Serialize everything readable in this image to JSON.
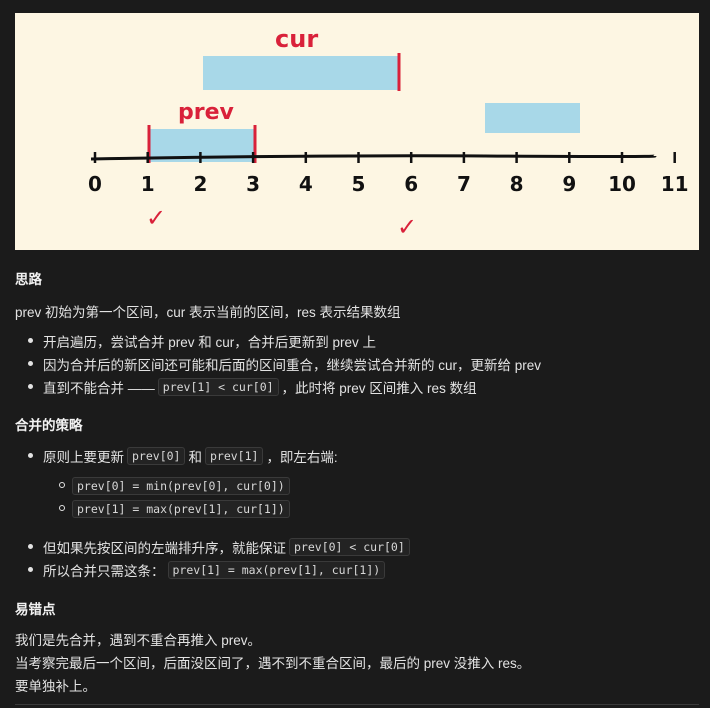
{
  "figure": {
    "axis_ticks": [
      "0",
      "1",
      "2",
      "3",
      "4",
      "5",
      "6",
      "7",
      "8",
      "9",
      "10",
      "11"
    ],
    "label_cur": "cur",
    "label_prev": "prev",
    "check_mark": "✓",
    "colors": {
      "background": "#fdf6e3",
      "interval": "#a8d8e8",
      "endpoint": "#d9213a",
      "axis": "#111111"
    }
  },
  "section1": {
    "title": "思路",
    "intro": "prev 初始为第一个区间，cur 表示当前的区间，res 表示结果数组",
    "items": [
      "开启遍历，尝试合并 prev 和 cur，合并后更新到 prev 上",
      "因为合并后的新区间还可能和后面的区间重合，继续尝试合并新的 cur，更新给 prev"
    ],
    "item3_before": "直到不能合并 ——",
    "item3_code": "prev[1] < cur[0]",
    "item3_after": "，此时将 prev 区间推入 res 数组"
  },
  "section2": {
    "title": "合并的策略",
    "item1_before": "原则上要更新",
    "item1_code1": "prev[0]",
    "item1_mid": "和",
    "item1_code2": "prev[1]",
    "item1_after": "，即左右端:",
    "sub1_code": "prev[0] = min(prev[0], cur[0])",
    "sub2_code": "prev[1] = max(prev[1], cur[1])",
    "item2_before": "但如果先按区间的左端排升序，就能保证",
    "item2_code": "prev[0] < cur[0]",
    "item3_before": "所以合并只需这条：",
    "item3_code": "prev[1] = max(prev[1], cur[1])"
  },
  "section3": {
    "title": "易错点",
    "line1": "我们是先合并，遇到不重合再推入 prev。",
    "line2": "当考察完最后一个区间，后面没区间了，遇不到不重合区间，最后的 prev 没推入 res。",
    "line3": "要单独补上。"
  }
}
